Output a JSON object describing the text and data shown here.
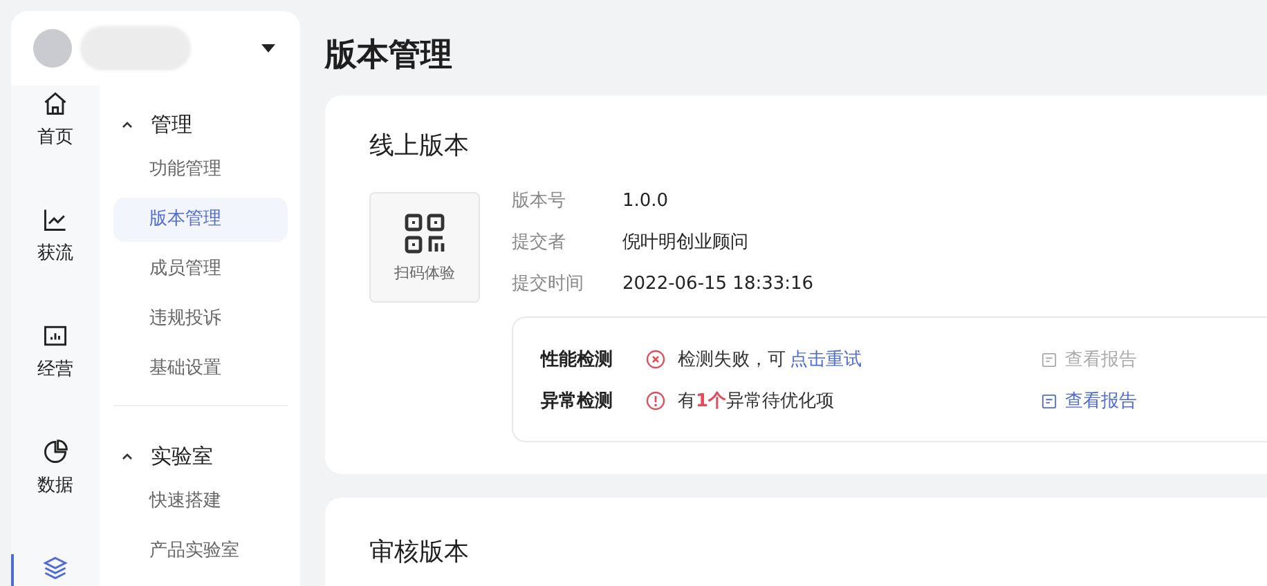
{
  "rail": [
    {
      "label": "首页",
      "kind": "home",
      "selected": false
    },
    {
      "label": "获流",
      "kind": "trend",
      "selected": false
    },
    {
      "label": "经营",
      "kind": "bars",
      "selected": false
    },
    {
      "label": "数据",
      "kind": "pie",
      "selected": false
    },
    {
      "kind": "layers",
      "selected": true
    }
  ],
  "nav": [
    {
      "title": "管理",
      "expanded": true,
      "items": [
        {
          "label": "功能管理",
          "selected": false
        },
        {
          "label": "版本管理",
          "selected": true
        },
        {
          "label": "成员管理",
          "selected": false
        },
        {
          "label": "违规投诉",
          "selected": false
        },
        {
          "label": "基础设置",
          "selected": false
        }
      ]
    },
    {
      "title": "实验室",
      "expanded": true,
      "items": [
        {
          "label": "快速搭建",
          "selected": false
        },
        {
          "label": "产品实验室",
          "selected": false
        }
      ]
    }
  ],
  "page_title": "版本管理",
  "online": {
    "title": "线上版本",
    "qr_label": "扫码体验",
    "fields": [
      {
        "label": "版本号",
        "value": "1.0.0"
      },
      {
        "label": "提交者",
        "value": "倪叶明创业顾问"
      },
      {
        "label": "提交时间",
        "value": "2022-06-15 18:33:16"
      }
    ],
    "checks": [
      {
        "label": "性能检测",
        "kind": "error",
        "message": "检测失败，可",
        "link": "点击重试",
        "report": "查看报告",
        "report_disabled": true
      },
      {
        "label": "异常检测",
        "kind": "warning",
        "message": "有**1个**异常待优化项",
        "report": "查看报告",
        "report_disabled": false
      }
    ]
  },
  "review": {
    "title": "审核版本"
  }
}
